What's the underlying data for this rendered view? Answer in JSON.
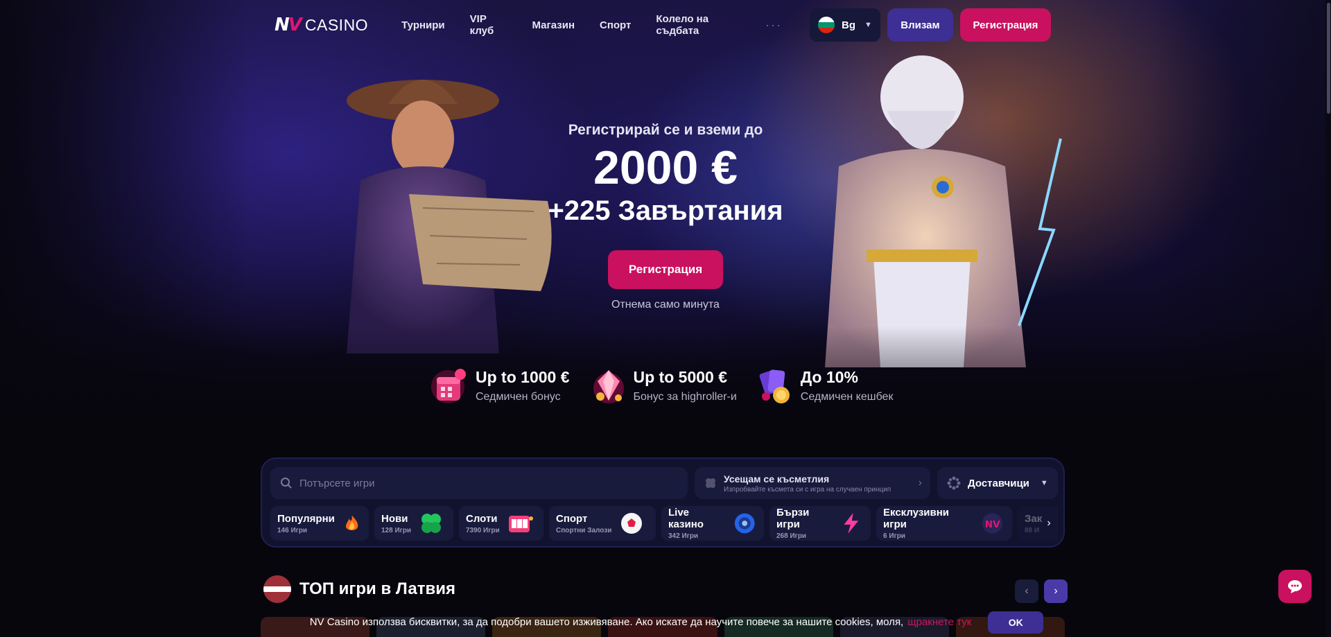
{
  "header": {
    "logo_mark": "NV",
    "logo_text": "CASINO",
    "nav": [
      {
        "label": "Турнири"
      },
      {
        "label": "VIP клуб"
      },
      {
        "label": "Магазин"
      },
      {
        "label": "Спорт"
      },
      {
        "label": "Колело на съдбата"
      }
    ],
    "more": "···",
    "language": {
      "code": "Bg",
      "flag_colors": [
        "#ffffff",
        "#00966e",
        "#d62612"
      ]
    },
    "login_label": "Влизам",
    "register_label": "Регистрация"
  },
  "hero": {
    "subtitle": "Регистрирай се и вземи до",
    "amount": "2000 €",
    "spins": "+225 Завъртания",
    "button_label": "Регистрация",
    "note": "Отнема само минута"
  },
  "bonuses": [
    {
      "icon": "calendar-gift-icon",
      "title": "Up to 1000 €",
      "subtitle": "Седмичен бонус"
    },
    {
      "icon": "diamond-icon",
      "title": "Up to 5000 €",
      "subtitle": "Бонус за highroller-и"
    },
    {
      "icon": "cashback-cards-icon",
      "title": "До 10%",
      "subtitle": "Седмичен кешбек"
    }
  ],
  "games_panel": {
    "search_placeholder": "Потърсете игри",
    "lucky": {
      "title": "Усещам се късметлия",
      "description": "Изпробвайте късмета си с игра на случаен принцип"
    },
    "providers_label": "Доставчици",
    "categories": [
      {
        "name": "Популярни",
        "count": "146 Игри",
        "icon": "fire-icon"
      },
      {
        "name": "Нови",
        "count": "128 Игри",
        "icon": "clover-icon"
      },
      {
        "name": "Слоти",
        "count": "7390 Игри",
        "icon": "slot-machine-icon"
      },
      {
        "name": "Спорт",
        "count": "Спортни Залози",
        "icon": "soccer-ball-icon"
      },
      {
        "name": "Live казино",
        "count": "342 Игри",
        "icon": "poker-chip-icon"
      },
      {
        "name": "Бързи игри",
        "count": "268 Игри",
        "icon": "lightning-icon"
      },
      {
        "name": "Ексклузивни игри",
        "count": "6 Игри",
        "icon": "nv-logo-icon"
      },
      {
        "name": "Зак",
        "count": "88 И",
        "icon": "partial-icon"
      }
    ]
  },
  "top_section": {
    "title": "ТОП игри в Латвия",
    "flag_colors": [
      "#9e3039",
      "#ffffff",
      "#9e3039"
    ]
  },
  "cookie": {
    "message": "NV Casino използва бисквитки, за да подобри вашето изживяване. Ако искате да научите повече за нашите cookies, моля,",
    "link": "щракнете тук",
    "ok_label": "OK"
  },
  "colors": {
    "accent_pink": "#c9115f",
    "accent_purple": "#3d2f93",
    "panel_bg": "#11132e",
    "page_bg": "#07060d"
  }
}
